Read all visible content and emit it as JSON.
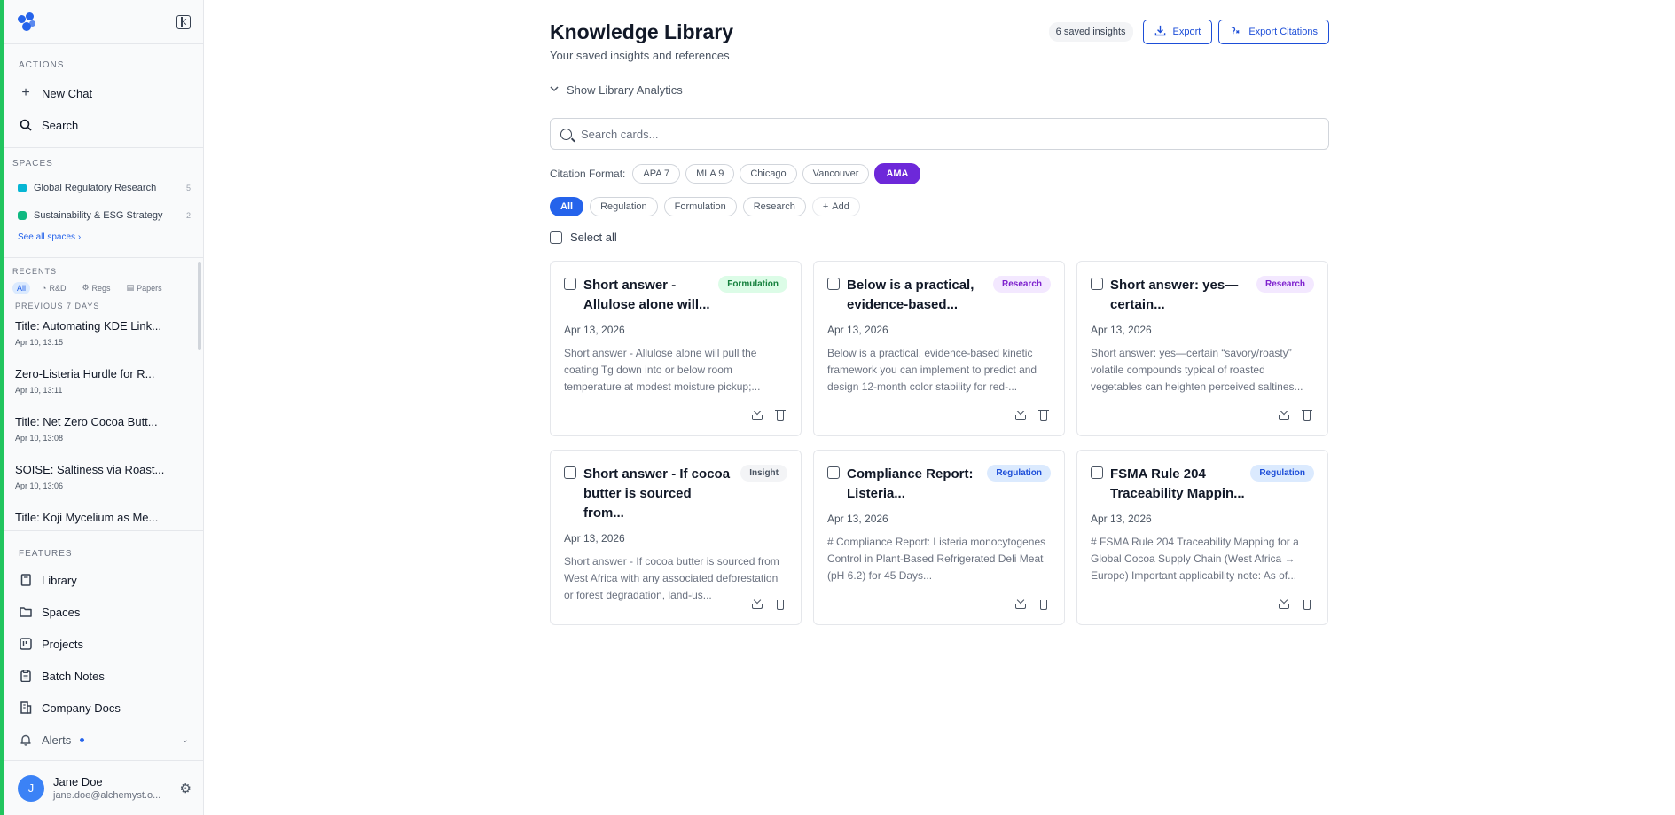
{
  "sidebar": {
    "actions_label": "ACTIONS",
    "new_chat": "New Chat",
    "search": "Search",
    "spaces_label": "SPACES",
    "spaces": [
      {
        "name": "Global Regulatory Research",
        "count": "5",
        "color": "#06b6d4"
      },
      {
        "name": "Sustainability & ESG Strategy",
        "count": "2",
        "color": "#10b981"
      }
    ],
    "see_all": "See all spaces",
    "recents_label": "RECENTS",
    "recent_filters": [
      "All",
      "R&D",
      "Regs",
      "Papers"
    ],
    "prev7_label": "PREVIOUS 7 DAYS",
    "recents": [
      {
        "title": "Title: Automating KDE Link...",
        "time": "Apr 10, 13:15"
      },
      {
        "title": "Zero-Listeria Hurdle for R...",
        "time": "Apr 10, 13:11"
      },
      {
        "title": "Title: Net Zero Cocoa Butt...",
        "time": "Apr 10, 13:08"
      },
      {
        "title": "SOISE: Saltiness via Roast...",
        "time": "Apr 10, 13:06"
      },
      {
        "title": "Title: Koji Mycelium as Me...",
        "time": ""
      }
    ],
    "features_label": "FEATURES",
    "features": [
      "Library",
      "Spaces",
      "Projects",
      "Batch Notes",
      "Company Docs"
    ],
    "alerts": "Alerts",
    "user": {
      "initial": "J",
      "name": "Jane Doe",
      "email": "jane.doe@alchemyst.o..."
    }
  },
  "header": {
    "title": "Knowledge Library",
    "subtitle": "Your saved insights and references",
    "saved_count": "6 saved insights",
    "export": "Export",
    "export_citations": "Export Citations"
  },
  "analytics_toggle": "Show Library Analytics",
  "search": {
    "placeholder": "Search cards..."
  },
  "citation": {
    "label": "Citation Format:",
    "formats": [
      "APA 7",
      "MLA 9",
      "Chicago",
      "Vancouver",
      "AMA"
    ],
    "selected": "AMA"
  },
  "filters": {
    "tags": [
      "All",
      "Regulation",
      "Formulation",
      "Research"
    ],
    "add": "Add",
    "selected": "All"
  },
  "select_all": "Select all",
  "cards": [
    {
      "title": "Short answer - Allulose alone will...",
      "tag": "Formulation",
      "date": "Apr 13, 2026",
      "excerpt": "Short answer - Allulose alone will pull the coating Tg down into or below room temperature at modest moisture pickup;..."
    },
    {
      "title": "Below is a practical, evidence-based...",
      "tag": "Research",
      "date": "Apr 13, 2026",
      "excerpt": "Below is a practical, evidence-based kinetic framework you can implement to predict and design 12-month color stability for red-..."
    },
    {
      "title": "Short answer: yes—certain...",
      "tag": "Research",
      "date": "Apr 13, 2026",
      "excerpt": "Short answer: yes—certain “savory/roasty” volatile compounds typical of roasted vegetables can heighten perceived saltines..."
    },
    {
      "title": "Short answer - If cocoa butter is sourced from...",
      "tag": "Insight",
      "date": "Apr 13, 2026",
      "excerpt": "Short answer - If cocoa butter is sourced from West Africa with any associated deforestation or forest degradation, land-us..."
    },
    {
      "title": "Compliance Report: Listeria...",
      "tag": "Regulation",
      "date": "Apr 13, 2026",
      "excerpt": "# Compliance Report: Listeria monocytogenes Control in Plant-Based Refrigerated Deli Meat (pH 6.2) for 45 Days..."
    },
    {
      "title": "FSMA Rule 204 Traceability Mappin...",
      "tag": "Regulation",
      "date": "Apr 13, 2026",
      "excerpt": "# FSMA Rule 204 Traceability Mapping for a Global Cocoa Supply Chain (West Africa → Europe) Important applicability note: As of..."
    }
  ]
}
